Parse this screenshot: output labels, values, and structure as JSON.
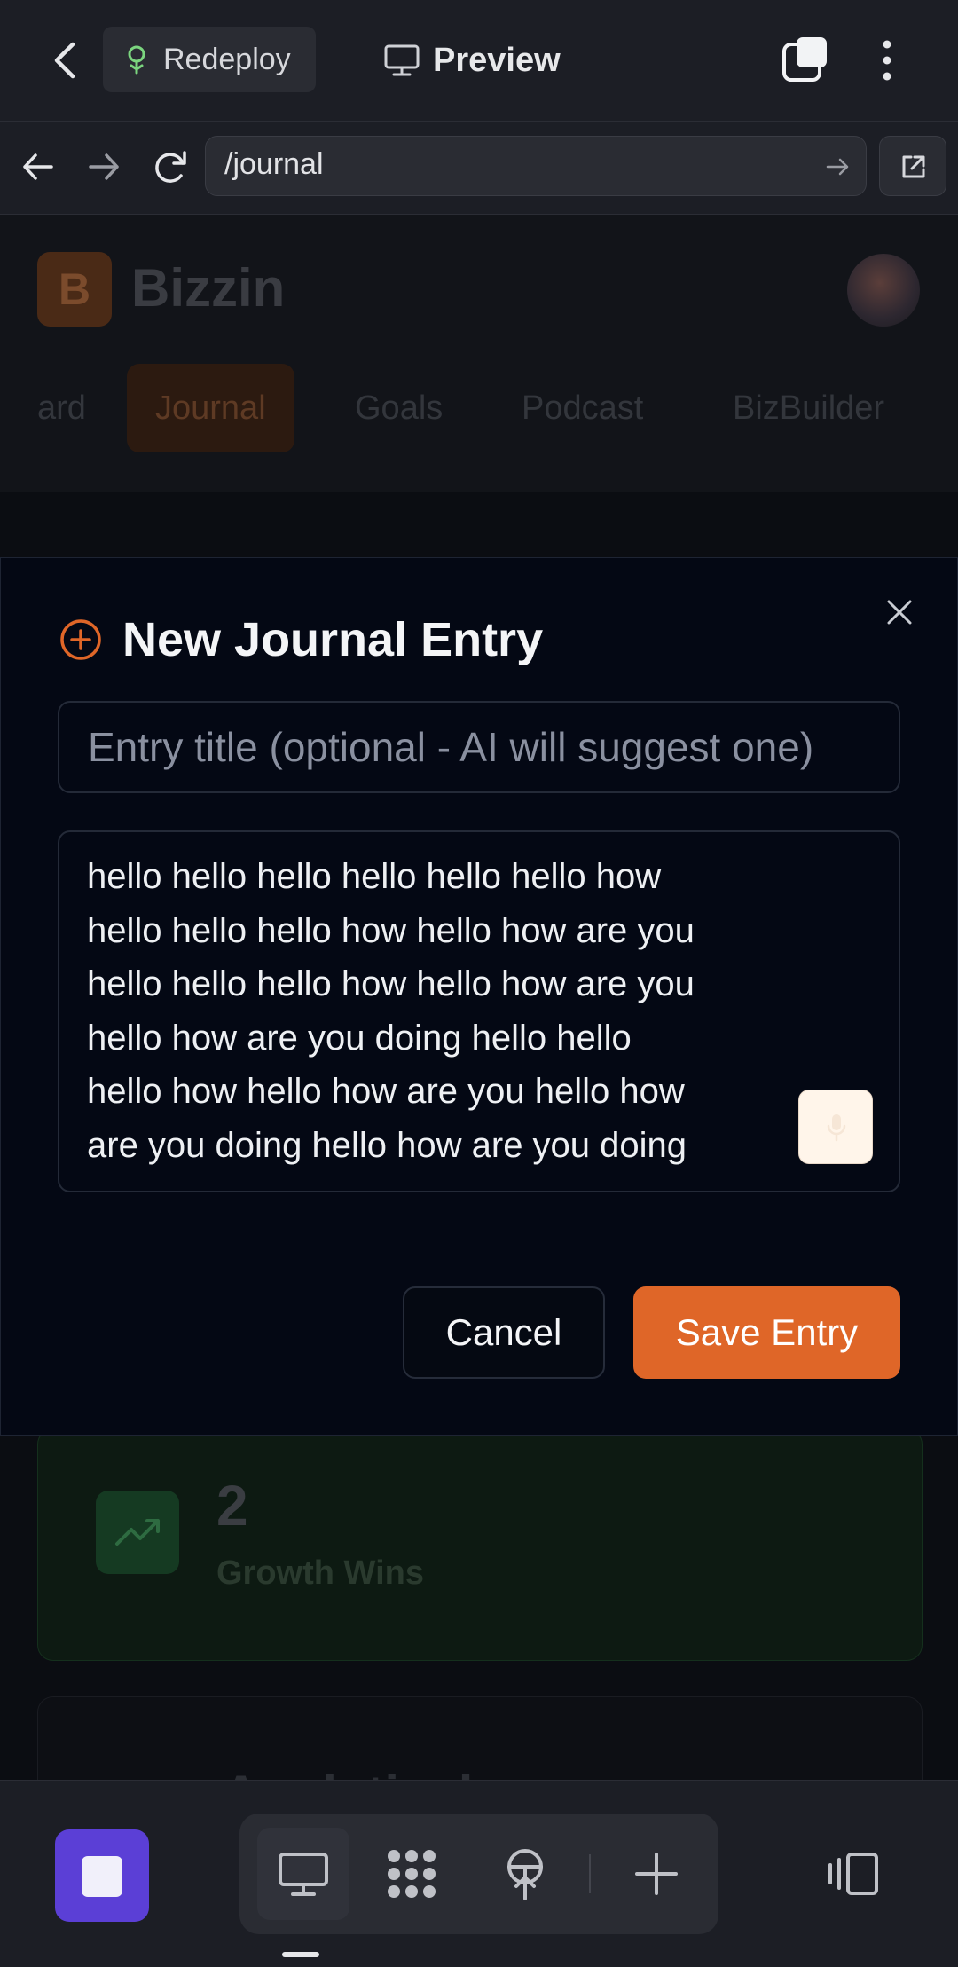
{
  "topbar": {
    "redeploy_label": "Redeploy",
    "preview_label": "Preview"
  },
  "browser": {
    "url": "/journal"
  },
  "app": {
    "logo_letter": "B",
    "brand": "Bizzin",
    "nav": [
      "ard",
      "Journal",
      "Goals",
      "Podcast",
      "BizBuilder"
    ],
    "active_nav": "Journal",
    "stats": {
      "value": "2",
      "label": "Growth Wins"
    },
    "card2_title": "Analytical..."
  },
  "modal": {
    "title": "New Journal Entry",
    "title_placeholder": "Entry title (optional - AI will suggest one)",
    "body_lines": [
      "hello hello hello hello hello hello how",
      "hello hello hello how hello how are you",
      "hello hello hello how hello how are you",
      "hello how are you doing hello hello",
      "hello how hello how are you hello how",
      "are you doing hello how are you doing"
    ],
    "cancel_label": "Cancel",
    "save_label": "Save Entry"
  },
  "colors": {
    "accent": "#df6628",
    "stop": "#5b3fd6",
    "modal_bg": "#040814"
  },
  "icons": [
    "back-icon",
    "sprout-icon",
    "monitor-icon",
    "tabs-icon",
    "kebab-icon",
    "arrow-left-icon",
    "arrow-right-icon",
    "reload-icon",
    "go-arrow-icon",
    "external-link-icon",
    "close-icon",
    "plus-circle-icon",
    "mic-icon",
    "stop-icon",
    "monitor-icon",
    "apps-grid-icon",
    "deploy-icon",
    "plus-icon",
    "sidebar-icon"
  ]
}
